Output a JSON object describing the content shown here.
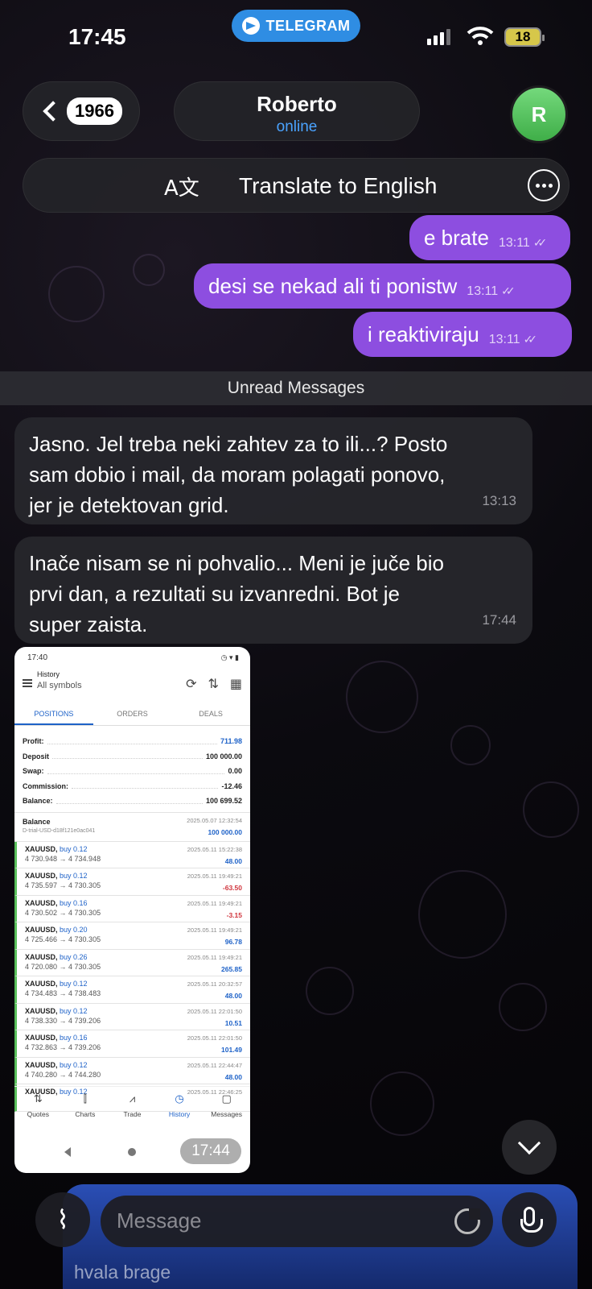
{
  "status_bar": {
    "time": "17:45",
    "app_pill": "TELEGRAM",
    "battery": "18"
  },
  "header": {
    "unread_count": "1966",
    "contact_name": "Roberto",
    "contact_status": "online",
    "avatar_letter": "R",
    "translate_label": "Translate to English"
  },
  "messages_out": [
    {
      "text": "e brate",
      "time": "13:11"
    },
    {
      "text": "desi se nekad ali ti ponistw",
      "time": "13:11"
    },
    {
      "text": "i reaktiviraju",
      "time": "13:11"
    }
  ],
  "unread_separator": "Unread Messages",
  "messages_in": [
    {
      "lines": [
        "Jasno. Jel treba neki zahtev za to ili...? Posto",
        "sam dobio i mail, da moram polagati ponovo,",
        "jer je detektovan grid."
      ],
      "time": "13:13"
    },
    {
      "lines": [
        "Inače nisam se ni pohvalio... Meni je juče bio",
        "prvi dan, a rezultati su izvanredni. Bot je",
        "super zaista."
      ],
      "time": "17:44"
    }
  ],
  "photo": {
    "time": "17:44",
    "status_time": "17:40",
    "title": "History",
    "subtitle": "All symbols",
    "tabs": [
      "POSITIONS",
      "ORDERS",
      "DEALS"
    ],
    "summary": [
      {
        "label": "Profit:",
        "value": "711.98",
        "blue": true
      },
      {
        "label": "Deposit",
        "value": "100 000.00"
      },
      {
        "label": "Swap:",
        "value": "0.00"
      },
      {
        "label": "Commission:",
        "value": "-12.46"
      },
      {
        "label": "Balance:",
        "value": "100 699.52"
      }
    ],
    "balance_entry": {
      "label": "Balance",
      "id": "D-trial-USD-d18f121e0ac041",
      "date": "2025.05.07 12:32:54",
      "amount": "100 000.00"
    },
    "deals": [
      {
        "symbol": "XAUUSD,",
        "side": "buy 0.12",
        "prices": "4 730.948 → 4 734.948",
        "date": "2025.05.11 15:22:38",
        "pl": "48.00"
      },
      {
        "symbol": "XAUUSD,",
        "side": "buy 0.12",
        "prices": "4 735.597 → 4 730.305",
        "date": "2025.05.11 19:49:21",
        "pl": "-63.50"
      },
      {
        "symbol": "XAUUSD,",
        "side": "buy 0.16",
        "prices": "4 730.502 → 4 730.305",
        "date": "2025.05.11 19:49:21",
        "pl": "-3.15"
      },
      {
        "symbol": "XAUUSD,",
        "side": "buy 0.20",
        "prices": "4 725.466 → 4 730.305",
        "date": "2025.05.11 19:49:21",
        "pl": "96.78"
      },
      {
        "symbol": "XAUUSD,",
        "side": "buy 0.26",
        "prices": "4 720.080 → 4 730.305",
        "date": "2025.05.11 19:49:21",
        "pl": "265.85"
      },
      {
        "symbol": "XAUUSD,",
        "side": "buy 0.12",
        "prices": "4 734.483 → 4 738.483",
        "date": "2025.05.11 20:32:57",
        "pl": "48.00"
      },
      {
        "symbol": "XAUUSD,",
        "side": "buy 0.12",
        "prices": "4 738.330 → 4 739.206",
        "date": "2025.05.11 22:01:50",
        "pl": "10.51"
      },
      {
        "symbol": "XAUUSD,",
        "side": "buy 0.16",
        "prices": "4 732.863 → 4 739.206",
        "date": "2025.05.11 22:01:50",
        "pl": "101.49"
      },
      {
        "symbol": "XAUUSD,",
        "side": "buy 0.12",
        "prices": "4 740.280 → 4 744.280",
        "date": "2025.05.11 22:44:47",
        "pl": "48.00"
      },
      {
        "symbol": "XAUUSD,",
        "side": "buy 0.12",
        "prices": "",
        "date": "2025.05.11 22:46:25",
        "pl": ""
      }
    ],
    "nav": [
      "Quotes",
      "Charts",
      "Trade",
      "History",
      "Messages"
    ]
  },
  "compose": {
    "placeholder": "Message",
    "reply_preview": "hvala brage"
  },
  "colors": {
    "outgoing_bubble": "#8d4ee0",
    "accent": "#2f8de3",
    "online": "#4aa3ff",
    "avatar": "#4fc158"
  },
  "icons": {
    "back": "chevron-left-icon",
    "translate": "translate-icon",
    "more": "more-icon",
    "attach": "paperclip-icon",
    "sticker": "sticker-icon",
    "mic": "microphone-icon",
    "scroll": "chevron-down-icon"
  }
}
